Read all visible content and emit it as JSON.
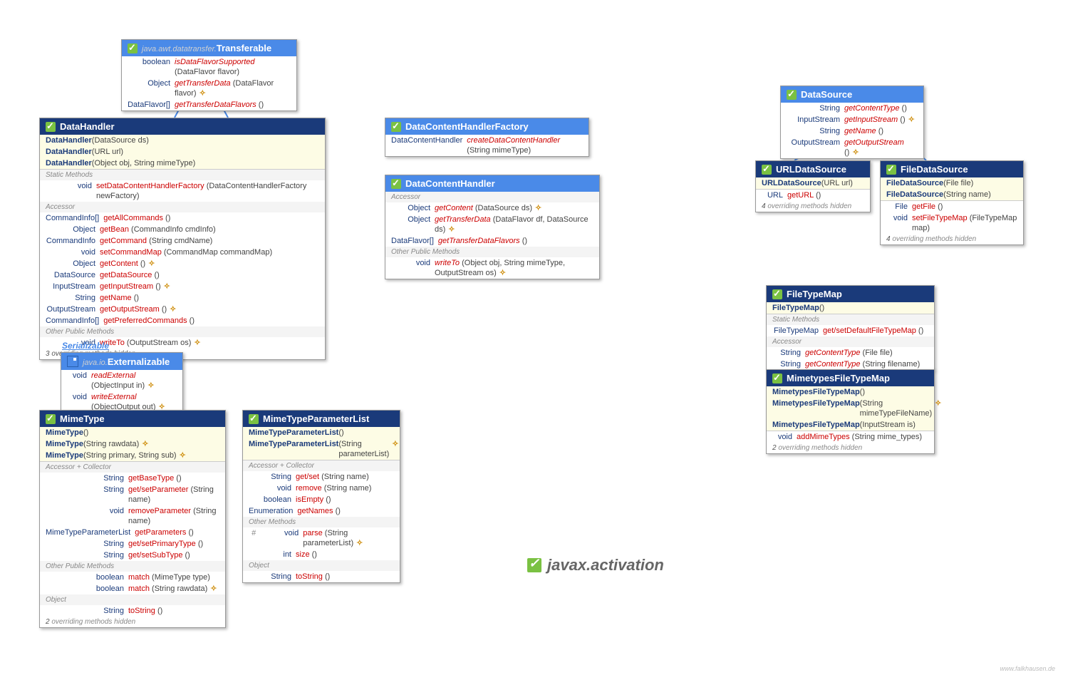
{
  "transferable": {
    "pkg": "java.awt.datatransfer.",
    "name": "Transferable",
    "rows": [
      {
        "t": "boolean",
        "m": "isDataFlavorSupported",
        "p": "(DataFlavor flavor)",
        "i": true
      },
      {
        "t": "Object",
        "m": "getTransferData",
        "p": "(DataFlavor flavor)",
        "i": true,
        "ex": true
      },
      {
        "t": "DataFlavor[]",
        "m": "getTransferDataFlavors",
        "p": "()",
        "i": true
      }
    ]
  },
  "datahandler": {
    "name": "DataHandler",
    "ctors": [
      {
        "n": "DataHandler",
        "p": "(DataSource ds)"
      },
      {
        "n": "DataHandler",
        "p": "(URL url)"
      },
      {
        "n": "DataHandler",
        "p": "(Object obj, String mimeType)"
      }
    ],
    "static": [
      {
        "t": "void",
        "m": "setDataContentHandlerFactory",
        "p": "(DataContentHandlerFactory newFactory)"
      }
    ],
    "acc": [
      {
        "t": "CommandInfo[]",
        "m": "getAllCommands",
        "p": "()"
      },
      {
        "t": "Object",
        "m": "getBean",
        "p": "(CommandInfo cmdInfo)"
      },
      {
        "t": "CommandInfo",
        "m": "getCommand",
        "p": "(String cmdName)"
      },
      {
        "t": "void",
        "m": "setCommandMap",
        "p": "(CommandMap commandMap)"
      },
      {
        "t": "Object",
        "m": "getContent",
        "p": "()",
        "ex": true
      },
      {
        "t": "DataSource",
        "m": "getDataSource",
        "p": "()"
      },
      {
        "t": "InputStream",
        "m": "getInputStream",
        "p": "()",
        "ex": true
      },
      {
        "t": "String",
        "m": "getName",
        "p": "()"
      },
      {
        "t": "OutputStream",
        "m": "getOutputStream",
        "p": "()",
        "ex": true
      },
      {
        "t": "CommandInfo[]",
        "m": "getPreferredCommands",
        "p": "()"
      }
    ],
    "other": [
      {
        "t": "void",
        "m": "writeTo",
        "p": "(OutputStream os)",
        "ex": true
      }
    ],
    "hidden": "3 overriding methods hidden",
    "labels": {
      "static": "Static Methods",
      "acc": "Accessor",
      "other": "Other Public Methods"
    }
  },
  "dchf": {
    "name": "DataContentHandlerFactory",
    "rows": [
      {
        "t": "DataContentHandler",
        "m": "createDataContentHandler",
        "p": "(String mimeType)",
        "i": true
      }
    ]
  },
  "dch": {
    "name": "DataContentHandler",
    "accLbl": "Accessor",
    "acc": [
      {
        "t": "Object",
        "m": "getContent",
        "p": "(DataSource ds)",
        "i": true,
        "ex": true
      },
      {
        "t": "Object",
        "m": "getTransferData",
        "p": "(DataFlavor df, DataSource ds)",
        "i": true,
        "ex": true
      },
      {
        "t": "DataFlavor[]",
        "m": "getTransferDataFlavors",
        "p": "()",
        "i": true
      }
    ],
    "otherLbl": "Other Public Methods",
    "other": [
      {
        "t": "void",
        "m": "writeTo",
        "p": "(Object obj, String mimeType, OutputStream os)",
        "i": true,
        "ex": true
      }
    ]
  },
  "datasource": {
    "name": "DataSource",
    "rows": [
      {
        "t": "String",
        "m": "getContentType",
        "p": "()",
        "i": true
      },
      {
        "t": "InputStream",
        "m": "getInputStream",
        "p": "()",
        "i": true,
        "ex": true
      },
      {
        "t": "String",
        "m": "getName",
        "p": "()",
        "i": true
      },
      {
        "t": "OutputStream",
        "m": "getOutputStream",
        "p": "()",
        "i": true,
        "ex": true
      }
    ]
  },
  "urlds": {
    "name": "URLDataSource",
    "ctors": [
      {
        "n": "URLDataSource",
        "p": "(URL url)"
      }
    ],
    "acc": [
      {
        "t": "URL",
        "m": "getURL",
        "p": "()"
      }
    ],
    "hidden": "4 overriding methods hidden"
  },
  "fileds": {
    "name": "FileDataSource",
    "ctors": [
      {
        "n": "FileDataSource",
        "p": "(File file)"
      },
      {
        "n": "FileDataSource",
        "p": "(String name)"
      }
    ],
    "acc": [
      {
        "t": "File",
        "m": "getFile",
        "p": "()"
      },
      {
        "t": "void",
        "m": "setFileTypeMap",
        "p": "(FileTypeMap map)"
      }
    ],
    "hidden": "4 overriding methods hidden"
  },
  "ftm": {
    "name": "FileTypeMap",
    "ctors": [
      {
        "n": "FileTypeMap",
        "p": "()"
      }
    ],
    "staticLbl": "Static Methods",
    "static": [
      {
        "t": "FileTypeMap",
        "m": "get/setDefaultFileTypeMap",
        "p": "()"
      }
    ],
    "accLbl": "Accessor",
    "acc": [
      {
        "t": "String",
        "m": "getContentType",
        "p": "(File file)",
        "i": true
      },
      {
        "t": "String",
        "m": "getContentType",
        "p": "(String filename)",
        "i": true
      }
    ]
  },
  "mftm": {
    "name": "MimetypesFileTypeMap",
    "ctors": [
      {
        "n": "MimetypesFileTypeMap",
        "p": "()"
      },
      {
        "n": "MimetypesFileTypeMap",
        "p": "(String mimeTypeFileName)",
        "ex": true
      },
      {
        "n": "MimetypesFileTypeMap",
        "p": "(InputStream is)"
      }
    ],
    "other": [
      {
        "t": "void",
        "m": "addMimeTypes",
        "p": "(String mime_types)"
      }
    ],
    "hidden": "2 overriding methods hidden"
  },
  "ser": {
    "label": "Serializable"
  },
  "ext": {
    "pkg": "java.io.",
    "name": "Externalizable",
    "rows": [
      {
        "t": "void",
        "m": "readExternal",
        "p": "(ObjectInput in)",
        "i": true,
        "ex": true
      },
      {
        "t": "void",
        "m": "writeExternal",
        "p": "(ObjectOutput out)",
        "i": true,
        "ex": true
      }
    ]
  },
  "mimetype": {
    "name": "MimeType",
    "ctors": [
      {
        "n": "MimeType",
        "p": "()"
      },
      {
        "n": "MimeType",
        "p": "(String rawdata)",
        "ex": true
      },
      {
        "n": "MimeType",
        "p": "(String primary, String sub)",
        "ex": true
      }
    ],
    "accLbl": "Accessor + Collector",
    "acc": [
      {
        "t": "String",
        "m": "getBaseType",
        "p": "()"
      },
      {
        "t": "String",
        "m": "get/setParameter",
        "p": "(String name)"
      },
      {
        "t": "void",
        "m": "removeParameter",
        "p": "(String name)"
      },
      {
        "t": "MimeTypeParameterList",
        "m": "getParameters",
        "p": "()"
      },
      {
        "t": "String",
        "m": "get/setPrimaryType",
        "p": "()"
      },
      {
        "t": "String",
        "m": "get/setSubType",
        "p": "()"
      }
    ],
    "otherLbl": "Other Public Methods",
    "other": [
      {
        "t": "boolean",
        "m": "match",
        "p": "(MimeType type)"
      },
      {
        "t": "boolean",
        "m": "match",
        "p": "(String rawdata)",
        "ex": true
      }
    ],
    "objLbl": "Object",
    "obj": [
      {
        "t": "String",
        "m": "toString",
        "p": "()"
      }
    ],
    "hidden": "2 overriding methods hidden"
  },
  "mtpl": {
    "name": "MimeTypeParameterList",
    "ctors": [
      {
        "n": "MimeTypeParameterList",
        "p": "()"
      },
      {
        "n": "MimeTypeParameterList",
        "p": "(String parameterList)",
        "ex": true
      }
    ],
    "accLbl": "Accessor + Collector",
    "acc": [
      {
        "t": "String",
        "m": "get/set",
        "p": "(String name)"
      },
      {
        "t": "void",
        "m": "remove",
        "p": "(String name)"
      },
      {
        "t": "boolean",
        "m": "isEmpty",
        "p": "()"
      },
      {
        "t": "Enumeration",
        "m": "getNames",
        "p": "()"
      }
    ],
    "otherLbl": "Other Methods",
    "other": [
      {
        "pre": "#",
        "t": "void",
        "m": "parse",
        "p": "(String parameterList)",
        "ex": true
      },
      {
        "t": "int",
        "m": "size",
        "p": "()"
      }
    ],
    "objLbl": "Object",
    "obj": [
      {
        "t": "String",
        "m": "toString",
        "p": "()"
      }
    ]
  },
  "pkgtitle": "javax.activation",
  "attribution": "www.falkhausen.de"
}
